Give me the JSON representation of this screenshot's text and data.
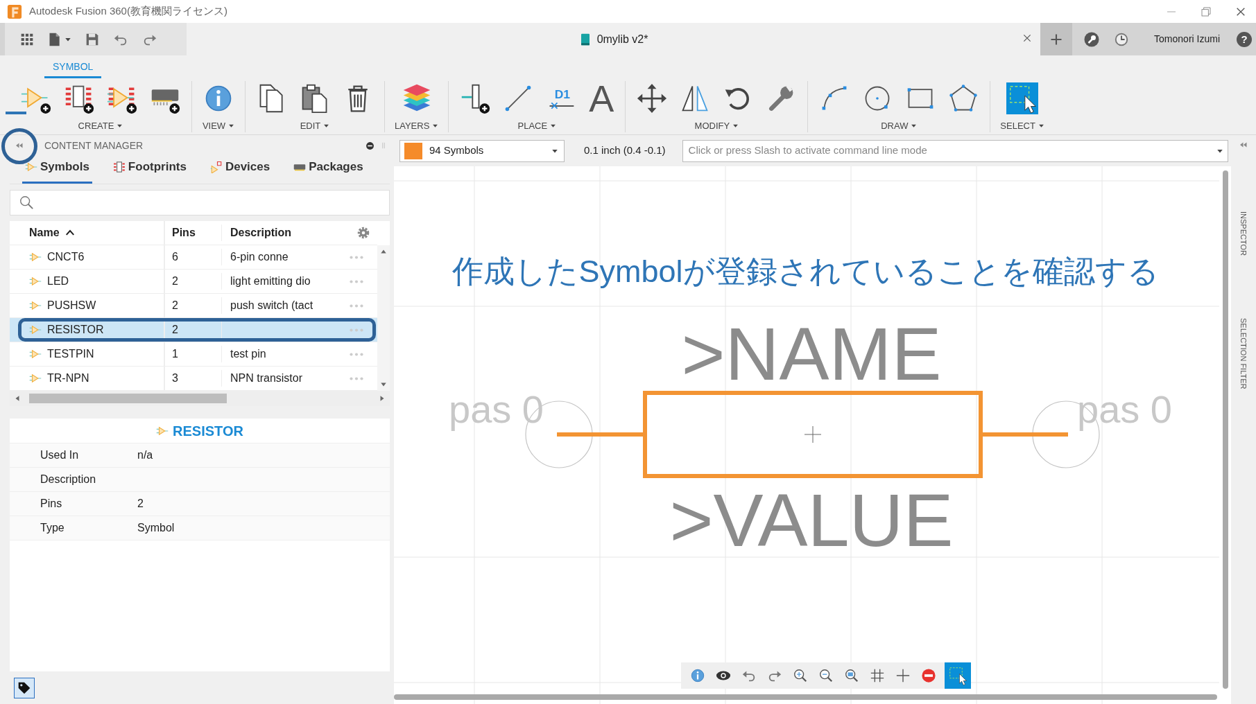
{
  "window": {
    "title": "Autodesk Fusion 360(教育機関ライセンス)"
  },
  "document_tab": {
    "title": "0mylib v2*"
  },
  "user": {
    "name": "Tomonori Izumi"
  },
  "help_button": {
    "label": "?"
  },
  "ribbon": {
    "tabs": [
      {
        "label": "SYMBOL",
        "selected": true
      }
    ],
    "groups": [
      {
        "label": "CREATE",
        "tools": [
          {
            "kind": "new-symbol"
          },
          {
            "kind": "new-footprint"
          },
          {
            "kind": "new-device"
          },
          {
            "kind": "new-package"
          }
        ]
      },
      {
        "label": "VIEW",
        "tools": [
          {
            "kind": "info"
          }
        ]
      },
      {
        "label": "EDIT",
        "tools": [
          {
            "kind": "copy"
          },
          {
            "kind": "paste"
          },
          {
            "kind": "delete"
          }
        ]
      },
      {
        "label": "LAYERS",
        "tools": [
          {
            "kind": "layers"
          }
        ]
      },
      {
        "label": "PLACE",
        "tools": [
          {
            "kind": "pin"
          },
          {
            "kind": "wire"
          },
          {
            "kind": "attribute",
            "label": "D1"
          },
          {
            "kind": "text",
            "label": "A"
          }
        ]
      },
      {
        "label": "MODIFY",
        "tools": [
          {
            "kind": "move"
          },
          {
            "kind": "mirror"
          },
          {
            "kind": "rotate"
          },
          {
            "kind": "wrench"
          }
        ]
      },
      {
        "label": "DRAW",
        "tools": [
          {
            "kind": "arc"
          },
          {
            "kind": "circle"
          },
          {
            "kind": "rectangle"
          },
          {
            "kind": "polygon"
          }
        ]
      },
      {
        "label": "SELECT",
        "tools": [
          {
            "kind": "select"
          }
        ]
      }
    ]
  },
  "content_manager": {
    "title": "CONTENT MANAGER",
    "tabs": [
      {
        "label": "Symbols",
        "kind": "symbol",
        "selected": true
      },
      {
        "label": "Footprints",
        "kind": "footprint",
        "selected": false
      },
      {
        "label": "Devices",
        "kind": "device",
        "selected": false
      },
      {
        "label": "Packages",
        "kind": "package",
        "selected": false
      }
    ],
    "table": {
      "columns": [
        {
          "label": "Name",
          "sorted": true
        },
        {
          "label": "Pins",
          "sorted": false
        },
        {
          "label": "Description",
          "sorted": false
        }
      ],
      "rows": [
        {
          "name": "CNCT6",
          "pins": "6",
          "description": "6-pin conne",
          "selected": false
        },
        {
          "name": "LED",
          "pins": "2",
          "description": "light emitting dio",
          "selected": false
        },
        {
          "name": "PUSHSW",
          "pins": "2",
          "description": "push switch (tact",
          "selected": false
        },
        {
          "name": "RESISTOR",
          "pins": "2",
          "selected": true
        },
        {
          "name": "TESTPIN",
          "pins": "1",
          "description": "test pin",
          "selected": false
        },
        {
          "name": "TR-NPN",
          "pins": "3",
          "description": "NPN transistor",
          "selected": false
        }
      ]
    },
    "details": {
      "title": "RESISTOR",
      "rows": [
        {
          "label": "Used In",
          "value": "n/a"
        },
        {
          "label": "Description"
        },
        {
          "label": "Pins",
          "value": "2"
        },
        {
          "label": "Type",
          "value": "Symbol"
        }
      ]
    }
  },
  "command_bar": {
    "layer": "94 Symbols",
    "grid": "0.1 inch (0.4 -0.1)",
    "command": {
      "placeholder": "Click or press Slash to activate command line mode"
    }
  },
  "side_panels": [
    {
      "label": "INSPECTOR"
    },
    {
      "label": "SELECTION FILTER"
    }
  ],
  "canvas": {
    "name_label": ">NAME",
    "value_label": ">VALUE",
    "pins": [
      {
        "label": "pas 0"
      },
      {
        "label": "pas 0"
      }
    ],
    "toolbar": [
      {
        "kind": "info"
      },
      {
        "kind": "eye"
      },
      {
        "kind": "undo"
      },
      {
        "kind": "redo"
      },
      {
        "kind": "zoom-in"
      },
      {
        "kind": "zoom-out"
      },
      {
        "kind": "zoom-fit"
      },
      {
        "kind": "grid"
      },
      {
        "kind": "crosshair"
      },
      {
        "kind": "stop"
      },
      {
        "kind": "select"
      }
    ]
  },
  "annotation": {
    "text": "作成したSymbolが登録されていることを確認する"
  }
}
